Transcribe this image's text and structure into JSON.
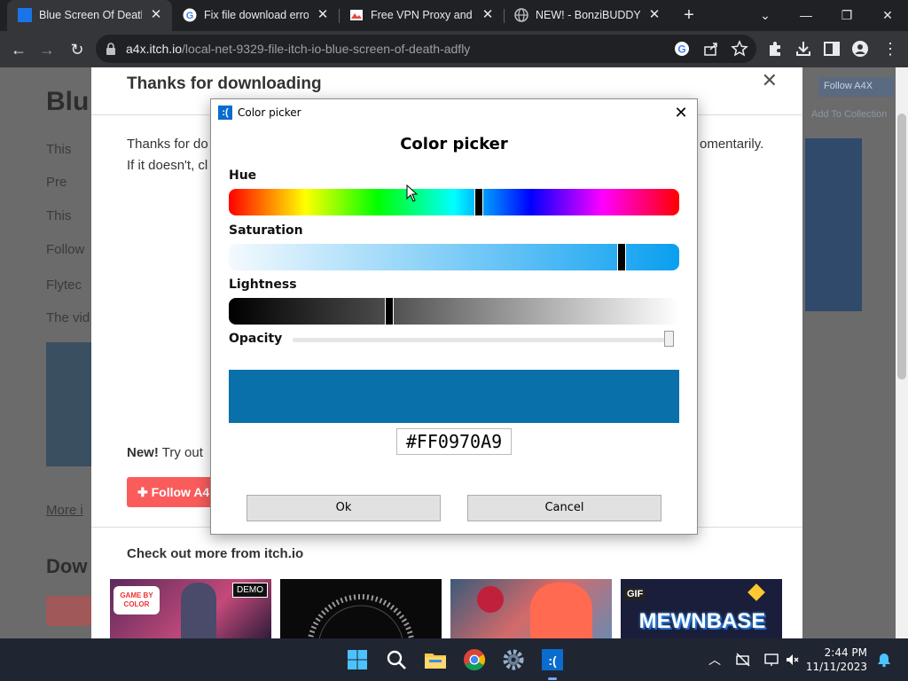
{
  "browser": {
    "tabs": [
      {
        "title": "Blue Screen Of Death S",
        "favicon": "itch-blue-square-icon",
        "active": true
      },
      {
        "title": "Fix file download error",
        "favicon": "google-icon",
        "active": false
      },
      {
        "title": "Free VPN Proxy and ad",
        "favicon": "vpn-site-icon",
        "active": false
      },
      {
        "title": "NEW! - BonziBUDDY!",
        "favicon": "globe-icon",
        "active": false
      }
    ],
    "url_host": "a4x.itch.io",
    "url_path": "/local-net-9329-file-itch-io-blue-screen-of-death-adfly"
  },
  "page": {
    "modal_title": "Thanks for downloading",
    "body_line1_start": "Thanks for do",
    "body_line1_end": "omentarily.",
    "body_line2": "If it doesn't, cl",
    "new_bold": "New!",
    "new_rest": " Try out",
    "follow_button": "Follow A4",
    "more_title": "Check out more from itch.io",
    "bg_title": "Blu",
    "bg_lines": [
      "This",
      "Pre",
      "This",
      "Follow",
      "Flytec",
      "The vid",
      "More i",
      "Dow"
    ],
    "side_buttons": [
      "Follow A4X",
      "Add To Collection"
    ],
    "thumb_labels": [
      "DEMO",
      "GIF",
      "MEWNBASE",
      "GAME BY COLOR"
    ]
  },
  "dialog": {
    "window_title": "Color picker",
    "heading": "Color picker",
    "hue_label": "Hue",
    "saturation_label": "Saturation",
    "lightness_label": "Lightness",
    "opacity_label": "Opacity",
    "hue_position": 0.557,
    "saturation_position": 0.88,
    "lightness_position": 0.354,
    "opacity_position": 1.0,
    "hex_value": "#FF0970A9",
    "preview_color": "#0970A9",
    "ok_label": "Ok",
    "cancel_label": "Cancel"
  },
  "taskbar": {
    "apps": [
      "windows-start-icon",
      "search-icon",
      "file-explorer-icon",
      "chrome-icon",
      "settings-gear-icon",
      "bsod-app-icon"
    ],
    "time": "2:44 PM",
    "date": "11/11/2023"
  }
}
